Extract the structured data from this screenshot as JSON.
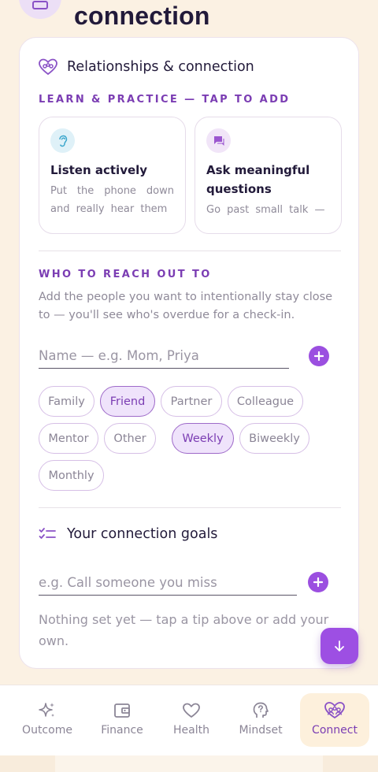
{
  "page": {
    "title": "connection"
  },
  "card": {
    "title": "Relationships & connection",
    "learn_label": "LEARN & PRACTICE — TAP TO ADD",
    "tips": [
      {
        "title": "Listen actively",
        "desc": "Put the phone down and really hear them",
        "icon": "ear-icon"
      },
      {
        "title": "Ask meaningful questions",
        "desc": "Go past small talk —",
        "icon": "chat-icon"
      }
    ],
    "reach_label": "WHO TO REACH OUT TO",
    "reach_desc": "Add the people you want to intentionally stay close to — you'll see who's overdue for a check-in.",
    "name_placeholder": "Name — e.g. Mom, Priya",
    "relations": [
      "Family",
      "Friend",
      "Partner",
      "Colleague",
      "Mentor",
      "Other"
    ],
    "relation_selected": "Friend",
    "frequencies": [
      "Weekly",
      "Biweekly",
      "Monthly"
    ],
    "frequency_selected": "Weekly",
    "goals_title": "Your connection goals",
    "goal_placeholder": "e.g. Call someone you miss",
    "empty_text": "Nothing set yet — tap a tip above or add your own."
  },
  "nav": {
    "items": [
      {
        "label": "Outcome",
        "icon": "sparkle-icon"
      },
      {
        "label": "Finance",
        "icon": "wallet-icon"
      },
      {
        "label": "Health",
        "icon": "heart-icon"
      },
      {
        "label": "Mindset",
        "icon": "head-icon"
      },
      {
        "label": "Connect",
        "icon": "people-icon"
      }
    ],
    "active": "Connect"
  },
  "colors": {
    "accent": "#9b4fe0",
    "accent_text": "#7b3db3",
    "background": "#fbf1e3",
    "nav_active": "#fdf0dc"
  }
}
